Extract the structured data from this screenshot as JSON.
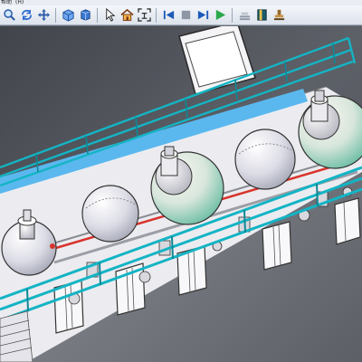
{
  "menubar": {
    "items": [
      "帮助",
      "(H)"
    ]
  },
  "toolbar": {
    "buttons": [
      {
        "name": "zoom-icon"
      },
      {
        "name": "rotate-icon"
      },
      {
        "name": "pan-icon"
      },
      {
        "name": "iso-view-icon"
      },
      {
        "name": "box-view-icon"
      },
      {
        "name": "select-arrow-icon"
      },
      {
        "name": "home-icon"
      },
      {
        "name": "fit-icon"
      },
      {
        "name": "first-frame-icon"
      },
      {
        "name": "stop-icon"
      },
      {
        "name": "last-frame-icon"
      },
      {
        "name": "play-icon"
      },
      {
        "name": "layers-icon"
      },
      {
        "name": "book-icon"
      },
      {
        "name": "stamp-icon"
      }
    ]
  },
  "scene": {
    "colors": {
      "background": "#6b6e74",
      "floor": "#ececf0",
      "rail": "#14b4c4",
      "blue_stripe": "#5ab8ee",
      "vessel_light": "#e8e8f0",
      "vessel_teal": "#7fc9b2",
      "accent_red": "#d8342c"
    }
  }
}
